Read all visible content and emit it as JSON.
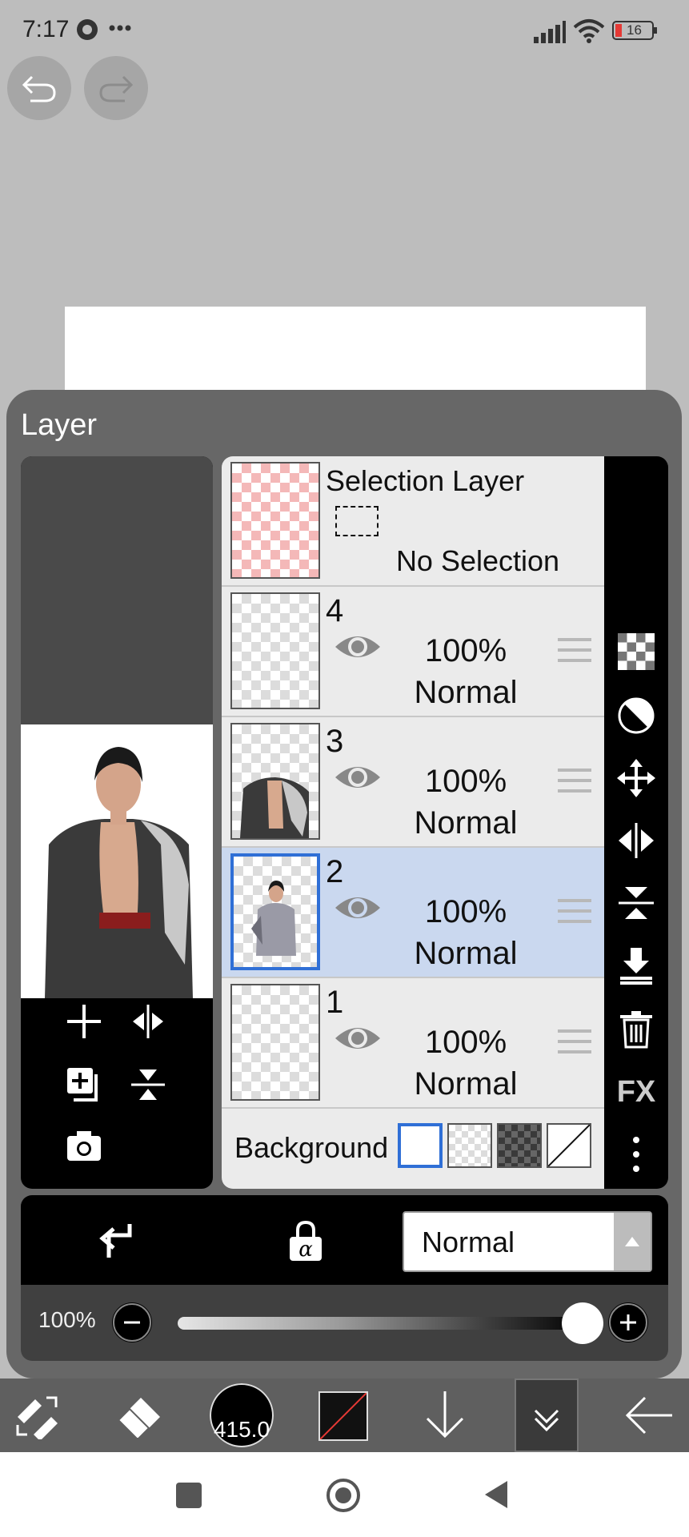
{
  "status_bar": {
    "time": "7:17",
    "battery": "16"
  },
  "panel": {
    "title": "Layer"
  },
  "selection_layer": {
    "name": "Selection Layer",
    "status": "No Selection"
  },
  "layers": [
    {
      "number": "4",
      "opacity": "100%",
      "blend": "Normal",
      "selected": false
    },
    {
      "number": "3",
      "opacity": "100%",
      "blend": "Normal",
      "selected": false
    },
    {
      "number": "2",
      "opacity": "100%",
      "blend": "Normal",
      "selected": true
    },
    {
      "number": "1",
      "opacity": "100%",
      "blend": "Normal",
      "selected": false
    }
  ],
  "background": {
    "label": "Background"
  },
  "tools_right": [
    "checker-icon",
    "circle-half-icon",
    "move-icon",
    "flip-horizontal-icon",
    "flip-vertical-icon",
    "merge-down-icon",
    "trash-icon",
    "fx-label",
    "more-icon"
  ],
  "fx_label": "FX",
  "blend_mode": {
    "value": "Normal"
  },
  "opacity_bar": {
    "label": "100%",
    "value": 1.0
  },
  "toolbar": {
    "brush_size": "415.0"
  },
  "colors": {
    "selected_row": "#cad8ef",
    "selected_border": "#2f6fd6",
    "selection_thumb": "#f4b8b8"
  }
}
